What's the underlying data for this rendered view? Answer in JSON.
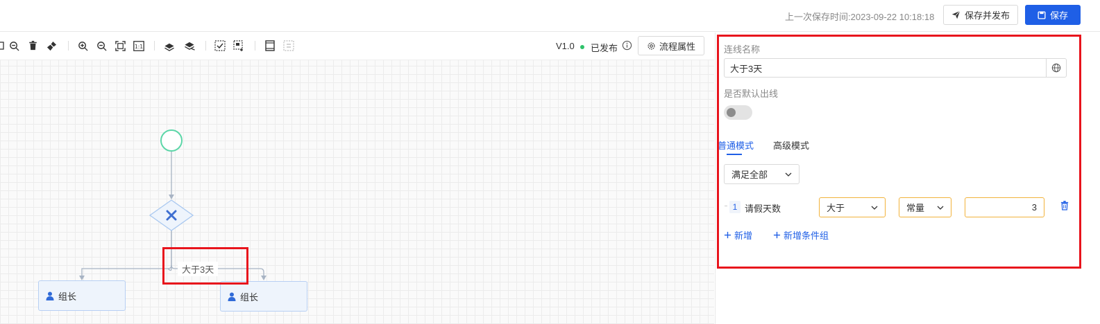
{
  "header": {
    "save_time_label": "上一次保存时间:",
    "save_time_value": "2023-09-22 10:18:18",
    "publish_label": "保存并发布",
    "save_label": "保存"
  },
  "toolbar": {
    "icons": [
      "zoom-out-icon",
      "delete-icon",
      "clean-icon",
      "zoom-in-icon",
      "zoom-out-icon",
      "fit-view-icon",
      "actual-size-icon",
      "undo-icon",
      "redo-icon",
      "select-icon",
      "multi-select-icon",
      "align-icon",
      "distribute-icon"
    ],
    "version": "V1.0",
    "status": "已发布",
    "status_color": "#2ec26a",
    "process_props_label": "流程属性"
  },
  "flow": {
    "start_icon": "start-circle-icon",
    "gateway_icon": "exclusive-gateway-icon",
    "nodes": [
      {
        "label": "组长",
        "icon": "user-icon"
      },
      {
        "label": "组长",
        "icon": "user-icon"
      }
    ],
    "edge_label": "大于3天"
  },
  "panel": {
    "line_name_label": "连线名称",
    "line_name_value": "大于3天",
    "default_out_label": "是否默认出线",
    "default_out_on": false,
    "tabs": [
      {
        "label": "普通模式",
        "active": true
      },
      {
        "label": "高级模式",
        "active": false
      }
    ],
    "match_select": "满足全部",
    "conditions": [
      {
        "index": "1",
        "field": "请假天数",
        "operator": "大于",
        "value_type": "常量",
        "value": "3"
      }
    ],
    "add_label": "新增",
    "add_group_label": "新增条件组",
    "accent_color": "#1f5fe6",
    "highlight_color": "#e8141c"
  }
}
